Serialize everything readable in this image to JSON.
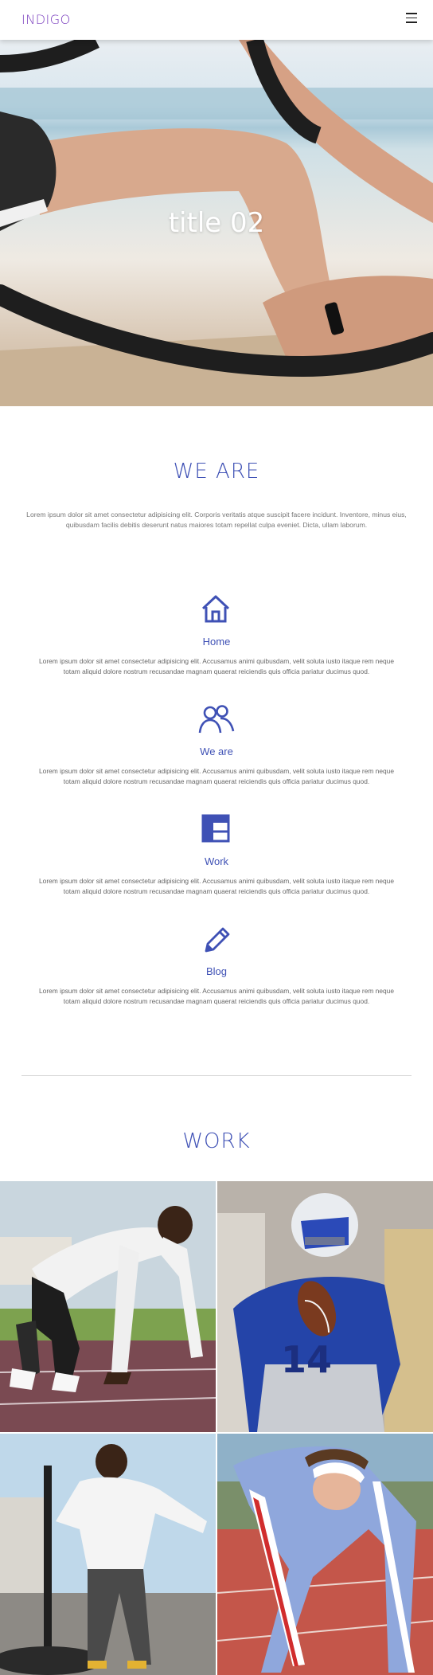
{
  "header": {
    "logo": "INDIGO",
    "menu_icon": "hamburger-icon"
  },
  "hero": {
    "title": "title 02"
  },
  "we_are": {
    "title": "WE ARE",
    "intro": "Lorem ipsum dolor sit amet consectetur adipisicing elit. Corporis veritatis atque suscipit facere incidunt. Inventore, minus eius, quibusdam facilis debitis deserunt natus maiores totam repellat culpa eveniet. Dicta, ullam laborum."
  },
  "features": [
    {
      "icon": "home-icon",
      "label": "Home",
      "text": "Lorem ipsum dolor sit amet consectetur adipisicing elit. Accusamus animi quibusdam, velit soluta iusto itaque rem neque totam aliquid dolore nostrum recusandae magnam quaerat reiciendis quis officia pariatur ducimus quod."
    },
    {
      "icon": "users-icon",
      "label": "We are",
      "text": "Lorem ipsum dolor sit amet consectetur adipisicing elit. Accusamus animi quibusdam, velit soluta iusto itaque rem neque totam aliquid dolore nostrum recusandae magnam quaerat reiciendis quis officia pariatur ducimus quod."
    },
    {
      "icon": "layout-icon",
      "label": "Work",
      "text": "Lorem ipsum dolor sit amet consectetur adipisicing elit. Accusamus animi quibusdam, velit soluta iusto itaque rem neque totam aliquid dolore nostrum recusandae magnam quaerat reiciendis quis officia pariatur ducimus quod."
    },
    {
      "icon": "pencil-icon",
      "label": "Blog",
      "text": "Lorem ipsum dolor sit amet consectetur adipisicing elit. Accusamus animi quibusdam, velit soluta iusto itaque rem neque totam aliquid dolore nostrum recusandae magnam quaerat reiciendis quis officia pariatur ducimus quod."
    }
  ],
  "work": {
    "title": "WORK"
  },
  "colors": {
    "accent": "#3f51b5",
    "logo": "#7b3fbf"
  }
}
